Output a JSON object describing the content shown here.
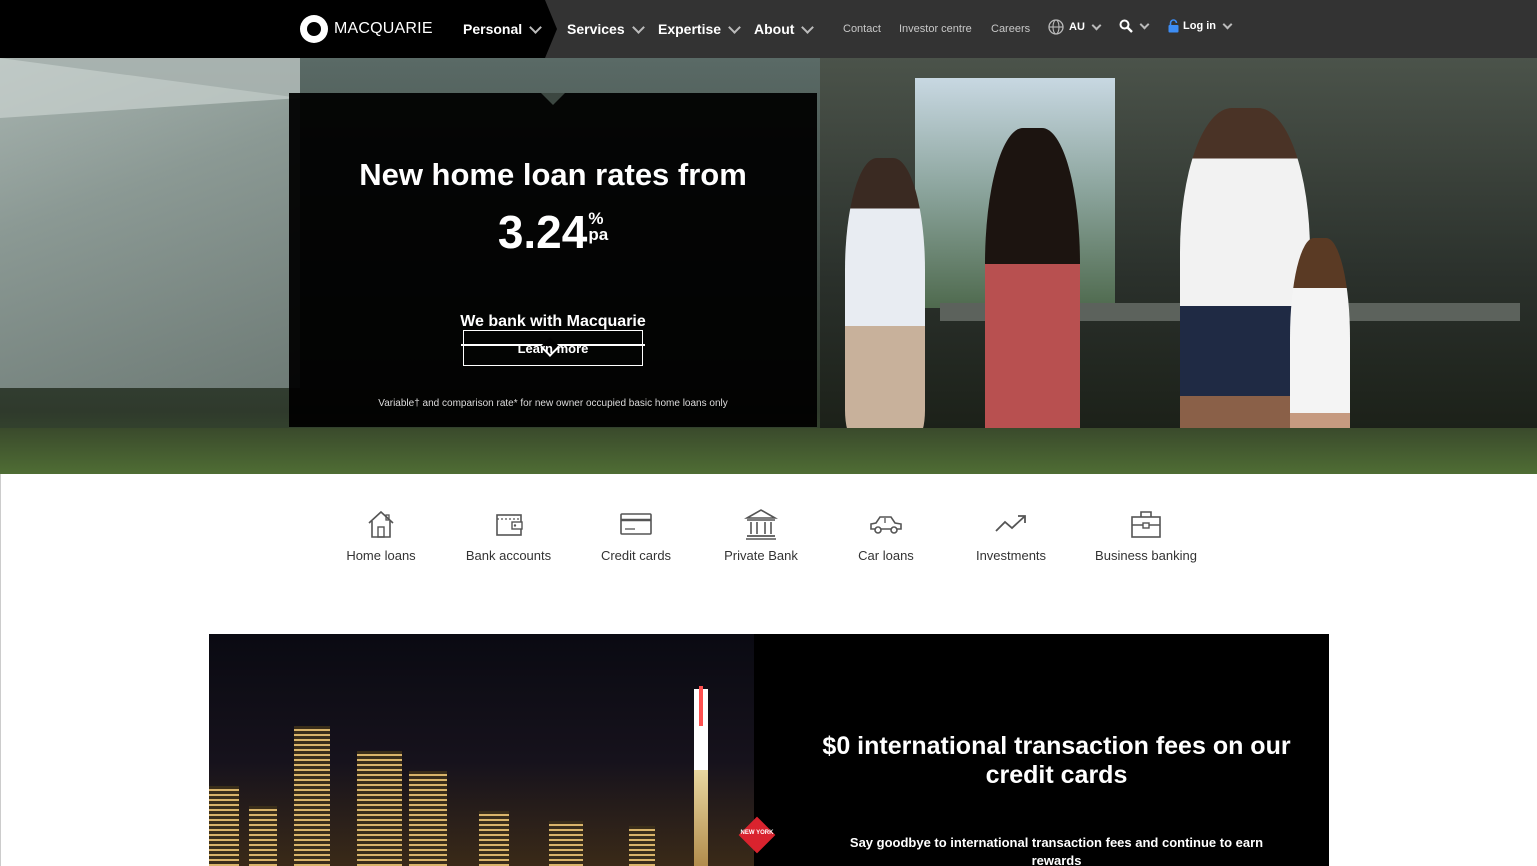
{
  "nav": {
    "logo_text": "MACQUARIE",
    "items": [
      {
        "label": "Personal"
      },
      {
        "label": "Services"
      },
      {
        "label": "Expertise"
      },
      {
        "label": "About"
      }
    ],
    "links": [
      "Contact",
      "Investor centre",
      "Careers"
    ],
    "region": "AU",
    "login": "Log in"
  },
  "hero": {
    "headline": "New home loan rates from",
    "rate_value": "3.24",
    "rate_unit_top": "%",
    "rate_unit_bottom": "pa",
    "tagline": "We bank with Macquarie",
    "cta": "Learn more",
    "disclaimer": "Variable† and comparison rate* for new owner occupied basic home loans only"
  },
  "quick_links": [
    {
      "label": "Home loans",
      "icon": "house-icon"
    },
    {
      "label": "Bank accounts",
      "icon": "wallet-icon"
    },
    {
      "label": "Credit cards",
      "icon": "credit-card-icon"
    },
    {
      "label": "Private Bank",
      "icon": "bank-building-icon"
    },
    {
      "label": "Car loans",
      "icon": "car-icon"
    },
    {
      "label": "Investments",
      "icon": "trend-up-icon"
    },
    {
      "label": "Business banking",
      "icon": "briefcase-icon"
    }
  ],
  "feature": {
    "title": "$0 international transaction fees on our credit cards",
    "body": "Say goodbye to international transaction fees and continue to earn rewards",
    "stamp": "NEW YORK"
  },
  "colors": {
    "nav_bg": "#333333",
    "nav_black": "#000000",
    "promo_bg": "#000000",
    "text_dark": "#333333"
  }
}
